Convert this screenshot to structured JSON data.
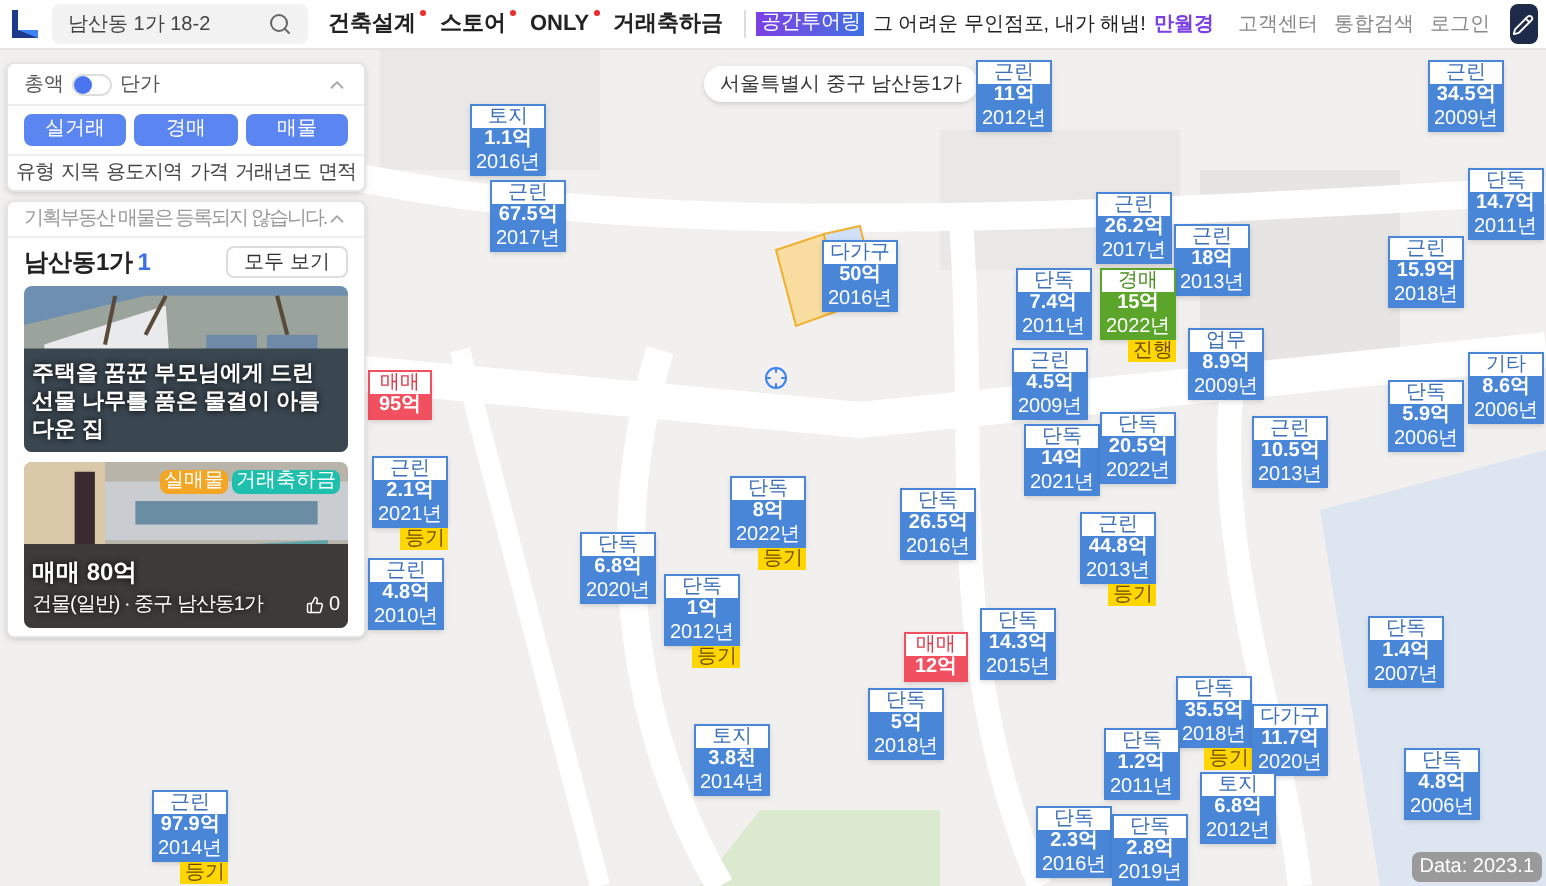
{
  "top_bar": {
    "search": {
      "value": "남산동 1가 18-2"
    },
    "nav": [
      {
        "label": "건축설계",
        "dot": true
      },
      {
        "label": "스토어",
        "dot": true
      },
      {
        "label": "ONLY",
        "dot": true
      },
      {
        "label": "거래축하금",
        "dot": false
      }
    ],
    "banner": {
      "badge": "공간투어링",
      "text": "그 어려운 무인점포, 내가 해냄!",
      "highlight": "만월경"
    },
    "links": [
      "고객센터",
      "통합검색",
      "로그인"
    ]
  },
  "filter_panel": {
    "toggle": {
      "left": "총액",
      "right": "단가",
      "unit_price": false
    },
    "buttons": [
      "실거래",
      "경매",
      "매물"
    ],
    "filters": [
      "유형",
      "지목",
      "용도지역",
      "가격",
      "거래년도",
      "면적"
    ]
  },
  "list_panel": {
    "notice": "기획부동산 매물은 등록되지 않습니다.",
    "title": "남산동1가",
    "count": "1",
    "view_all": "모두 보기",
    "cards": [
      {
        "kind": "story",
        "title": "주택을 꿈꾼 부모님에게 드린 선물 나무를 품은 물결이 아름다운 집"
      },
      {
        "kind": "listing",
        "tags": [
          {
            "label": "실매물",
            "color": "#f5a524"
          },
          {
            "label": "거래축하금",
            "color": "#1fbfae"
          }
        ],
        "price": "매매 80억",
        "detail": "건물(일반) · 중구 남산동1가",
        "likes": "0"
      }
    ]
  },
  "map": {
    "address": "서울특별시 중구 남산동1가",
    "data_date": "Data: 2023.1",
    "markers": [
      {
        "kind": "sale",
        "category": "토지",
        "price": "1.1억",
        "year": "2016년"
      },
      {
        "kind": "sale",
        "category": "근린",
        "price": "67.5억",
        "year": "2017년"
      },
      {
        "kind": "sale",
        "category": "근린",
        "price": "11억",
        "year": "2012년"
      },
      {
        "kind": "sale",
        "category": "다가구",
        "price": "50억",
        "year": "2016년"
      },
      {
        "kind": "sale",
        "category": "근린",
        "price": "34.5억",
        "year": "2009년"
      },
      {
        "kind": "sale",
        "category": "근린",
        "price": "26.2억",
        "year": "2017년"
      },
      {
        "kind": "sale",
        "category": "근린",
        "price": "18억",
        "year": "2013년"
      },
      {
        "kind": "sale",
        "category": "단독",
        "price": "7.4억",
        "year": "2011년"
      },
      {
        "kind": "auction",
        "category": "경매",
        "price": "15억",
        "year": "2022년",
        "tag": "진행"
      },
      {
        "kind": "sale",
        "category": "근린",
        "price": "15.9억",
        "year": "2018년"
      },
      {
        "kind": "sale",
        "category": "단독",
        "price": "14.7억",
        "year": "2011년"
      },
      {
        "kind": "sale",
        "category": "업무",
        "price": "8.9억",
        "year": "2009년"
      },
      {
        "kind": "sale",
        "category": "근린",
        "price": "4.5억",
        "year": "2009년"
      },
      {
        "kind": "sale",
        "category": "기타",
        "price": "8.6억",
        "year": "2006년"
      },
      {
        "kind": "sale",
        "category": "단독",
        "price": "5.9억",
        "year": "2006년"
      },
      {
        "kind": "sale",
        "category": "단독",
        "price": "14억",
        "year": "2021년"
      },
      {
        "kind": "sale",
        "category": "단독",
        "price": "20.5억",
        "year": "2022년"
      },
      {
        "kind": "sale",
        "category": "근린",
        "price": "10.5억",
        "year": "2013년"
      },
      {
        "kind": "sale",
        "category": "근린",
        "price": "2.1억",
        "year": "2021년",
        "tag": "등기"
      },
      {
        "kind": "sale",
        "category": "단독",
        "price": "8억",
        "year": "2022년",
        "tag": "등기"
      },
      {
        "kind": "sale",
        "category": "단독",
        "price": "26.5억",
        "year": "2016년"
      },
      {
        "kind": "sale",
        "category": "단독",
        "price": "6.8억",
        "year": "2020년"
      },
      {
        "kind": "sale",
        "category": "단독",
        "price": "1억",
        "year": "2012년",
        "tag": "등기"
      },
      {
        "kind": "listing",
        "category": "매매",
        "price": "12억"
      },
      {
        "kind": "sale",
        "category": "토지",
        "price": "3.8천",
        "year": "2014년"
      },
      {
        "kind": "sale",
        "category": "단독",
        "price": "5억",
        "year": "2018년"
      },
      {
        "kind": "sale",
        "category": "근린",
        "price": "44.8억",
        "year": "2013년",
        "tag": "등기"
      },
      {
        "kind": "sale",
        "category": "단독",
        "price": "14.3억",
        "year": "2015년"
      },
      {
        "kind": "sale",
        "category": "단독",
        "price": "1.4억",
        "year": "2007년"
      },
      {
        "kind": "sale",
        "category": "단독",
        "price": "35.5억",
        "year": "2018년",
        "tag": "등기"
      },
      {
        "kind": "sale",
        "category": "다가구",
        "price": "11.7억",
        "year": "2020년"
      },
      {
        "kind": "sale",
        "category": "단독",
        "price": "1.2억",
        "year": "2011년"
      },
      {
        "kind": "sale",
        "category": "단독",
        "price": "4.8억",
        "year": "2006년"
      },
      {
        "kind": "sale",
        "category": "토지",
        "price": "6.8억",
        "year": "2012년"
      },
      {
        "kind": "sale",
        "category": "근린",
        "price": "97.9억",
        "year": "2014년",
        "tag": "등기"
      },
      {
        "kind": "sale",
        "category": "단독",
        "price": "2.3억",
        "year": "2016년"
      },
      {
        "kind": "sale",
        "category": "단독",
        "price": "2.8억",
        "year": "2019년"
      },
      {
        "kind": "listing",
        "category": "매매",
        "price": "95억"
      },
      {
        "kind": "sale",
        "category": "근린",
        "price": "4.8억",
        "year": "2010년"
      }
    ]
  }
}
